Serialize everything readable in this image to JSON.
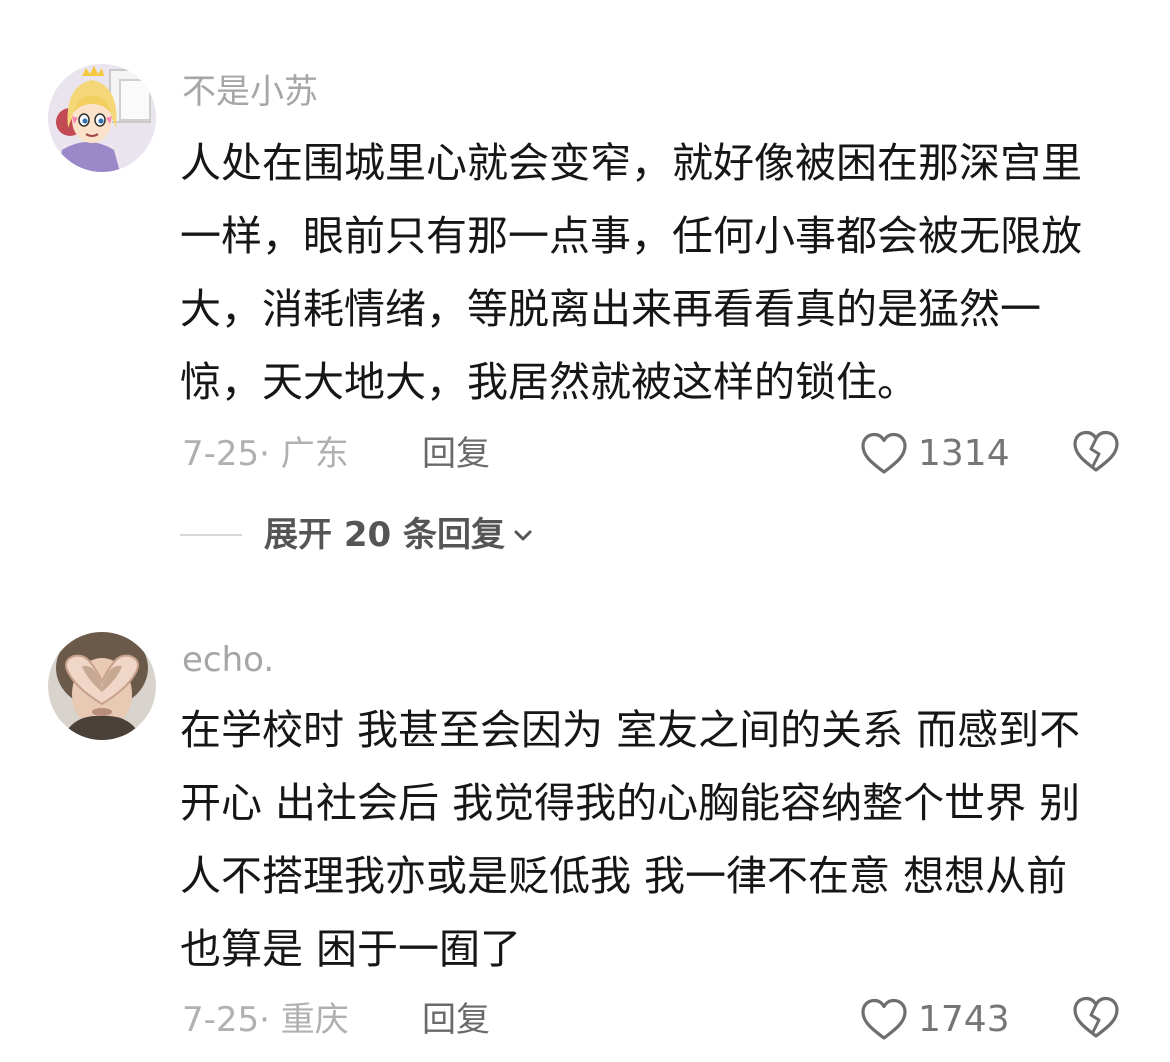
{
  "comments": [
    {
      "avatar_icon": "cartoon-girl-avatar",
      "username": "不是小苏",
      "text": "人处在围城里心就会变窄，就好像被困在那深宫里一样，眼前只有那一点事，任何小事都会被无限放大，消耗情绪，等脱离出来再看看真的是猛然一惊，天大地大，我居然就被这样的锁住。",
      "date": "7-25",
      "location": "广东",
      "reply_label": "回复",
      "like_count": "1314",
      "expand_replies_label": "展开 20 条回复"
    },
    {
      "avatar_icon": "heart-hands-photo-avatar",
      "username": "echo.",
      "text": "在学校时 我甚至会因为 室友之间的关系 而感到不开心 出社会后 我觉得我的心胸能容纳整个世界 别人不搭理我亦或是贬低我 我一律不在意 想想从前 也算是 困于一囿了",
      "date": "7-25",
      "location": "重庆",
      "reply_label": "回复",
      "like_count": "1743"
    }
  ],
  "icons": {
    "like": "heart-outline-icon",
    "dislike": "broken-heart-icon",
    "expand": "chevron-down-icon"
  },
  "colors": {
    "text": "#161616",
    "username": "#a6a6a6",
    "meta": "#b0b0b0",
    "icon": "#6e6e6e"
  }
}
